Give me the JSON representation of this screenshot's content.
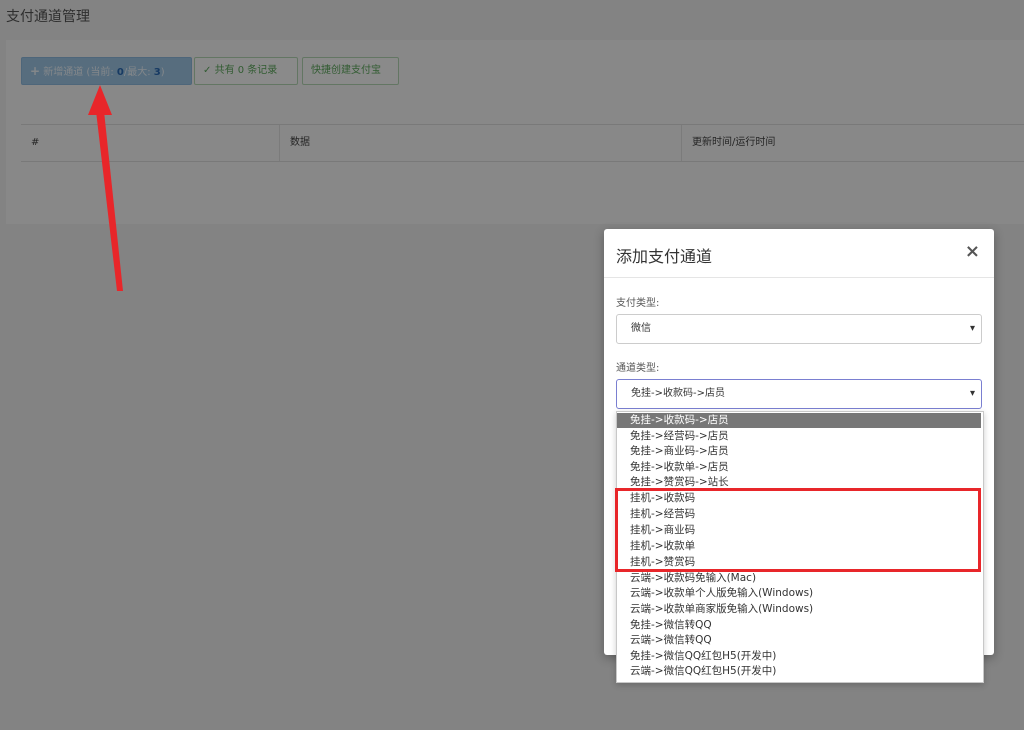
{
  "page": {
    "title": "支付通道管理"
  },
  "toolbar": {
    "add_prefix": "新增通道 (当前: ",
    "add_current": "0",
    "add_middle": "/最大: ",
    "add_max": "3",
    "add_suffix": ")",
    "add_icon": "plus-icon",
    "count_label": "共有 0 条记录",
    "count_icon": "check-icon",
    "quick_label": "快捷创建支付宝"
  },
  "table": {
    "columns": [
      "#",
      "数据",
      "更新时间/运行时间"
    ]
  },
  "modal": {
    "title": "添加支付通道",
    "close": "×",
    "pay_type_label": "支付类型:",
    "pay_type_value": "微信",
    "channel_type_label": "通道类型:",
    "channel_type_value": "免挂->收款码->店员"
  },
  "dropdown": {
    "options": [
      "免挂->收款码->店员",
      "免挂->经营码->店员",
      "免挂->商业码->店员",
      "免挂->收款单->店员",
      "免挂->赞赏码->站长",
      "挂机->收款码",
      "挂机->经营码",
      "挂机->商业码",
      "挂机->收款单",
      "挂机->赞赏码",
      "云端->收款码免输入(Mac)",
      "云端->收款单个人版免输入(Windows)",
      "云端->收款单商家版免输入(Windows)",
      "免挂->微信转QQ",
      "云端->微信转QQ",
      "免挂->微信QQ红包H5(开发中)",
      "云端->微信QQ红包H5(开发中)"
    ],
    "selected_index": 0
  },
  "annotation": {
    "highlight_color": "#e8262a",
    "arrow_color": "#e8262a"
  }
}
